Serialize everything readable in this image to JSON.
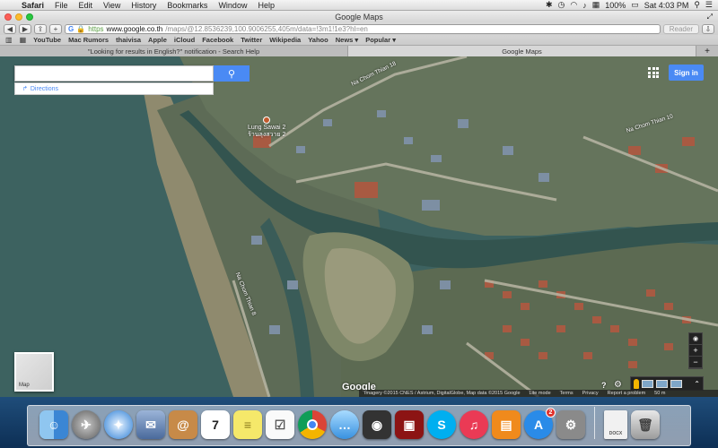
{
  "menubar": {
    "apple_icon": "apple-logo",
    "items": [
      "Safari",
      "File",
      "Edit",
      "View",
      "History",
      "Bookmarks",
      "Window",
      "Help"
    ],
    "battery": "100%",
    "clock": "Sat 4:03 PM"
  },
  "window": {
    "title": "Google Maps"
  },
  "toolbar": {
    "back": "◀",
    "forward": "▶",
    "share": "⇪",
    "new_tab": "+",
    "url_lock": "🔒",
    "url_scheme": "https",
    "url_host": "www.google.co.th",
    "url_path": "/maps/@12.8536239,100.9006255,405m/data=!3m1!1e3?hl=en",
    "reader": "Reader",
    "download": "⇩"
  },
  "favorites": {
    "items": [
      "YouTube",
      "Mac Rumors",
      "thaivisa",
      "Apple",
      "iCloud",
      "Facebook",
      "Twitter",
      "Wikipedia",
      "Yahoo",
      "News ▾",
      "Popular ▾"
    ]
  },
  "tabs": [
    {
      "label": "\"Looking for results in English?\" notification - Search Help"
    },
    {
      "label": "Google Maps"
    }
  ],
  "map": {
    "search_placeholder": "",
    "directions_label": "Directions",
    "signin_label": "Sign in",
    "poi_name_line1": "Lung Sawai 2",
    "poi_name_line2": "ร้านลุงสวาย 2",
    "road_labels": [
      "Na Chom Thian 18",
      "Na Chom Thian 8",
      "Na Chom Thian 10"
    ],
    "earth_label": "Map",
    "google_logo": "Google",
    "zoom_in": "+",
    "zoom_out": "−",
    "help": "?",
    "footer": [
      "Imagery ©2015 CNES / Astrium, DigitalGlobe, Map data ©2015 Google",
      "Lite mode",
      "Terms",
      "Privacy",
      "Report a problem",
      "50 m"
    ]
  },
  "dock": {
    "calendar_day": "7",
    "appstore_badge": "2",
    "doc_label": "DOCX",
    "icons": [
      "finder-icon",
      "launchpad-icon",
      "safari-icon",
      "mail-icon",
      "contacts-icon",
      "calendar-icon",
      "notes-icon",
      "reminders-icon",
      "chrome-icon",
      "messages-icon",
      "facetime-icon",
      "photobooth-icon",
      "skype-icon",
      "itunes-icon",
      "ibooks-icon",
      "appstore-icon",
      "preferences-icon",
      "document-icon",
      "trash-icon"
    ]
  }
}
